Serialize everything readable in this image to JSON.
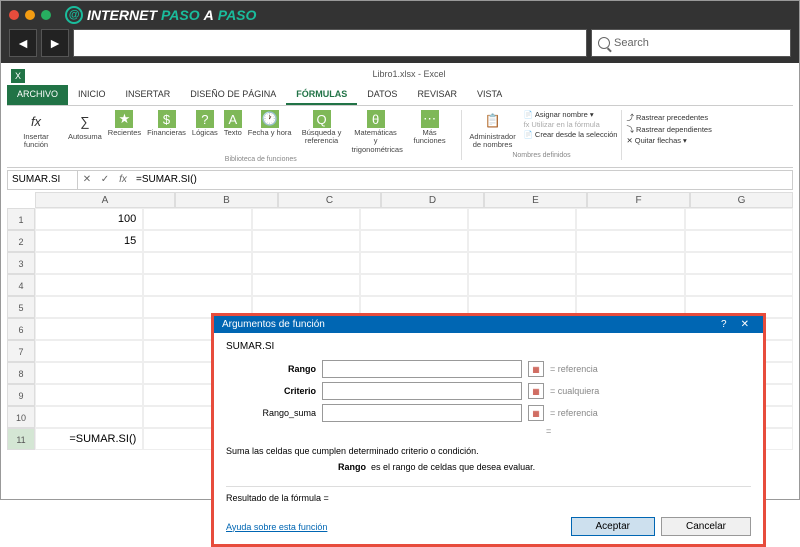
{
  "browser": {
    "logo_text1": "INTERNET",
    "logo_text2": "PASO",
    "logo_text3": "A",
    "logo_text4": "PASO",
    "search_placeholder": "Search"
  },
  "excel": {
    "doc_title": "Libro1.xlsx - Excel",
    "tabs": {
      "archivo": "ARCHIVO",
      "inicio": "INICIO",
      "insertar": "INSERTAR",
      "diseno": "DISEÑO DE PÁGINA",
      "formulas": "FÓRMULAS",
      "datos": "DATOS",
      "revisar": "REVISAR",
      "vista": "VISTA"
    },
    "ribbon": {
      "insertar_fn": "Insertar función",
      "autosuma": "Autosuma",
      "recientes": "Recientes",
      "financieras": "Financieras",
      "logicas": "Lógicas",
      "texto": "Texto",
      "fecha": "Fecha y hora",
      "busqueda": "Búsqueda y referencia",
      "matematicas": "Matemáticas y trigonométricas",
      "mas": "Más funciones",
      "biblioteca": "Biblioteca de funciones",
      "admin": "Administrador de nombres",
      "asignar": "Asignar nombre",
      "utilizar": "Utilizar en la fórmula",
      "crear": "Crear desde la selección",
      "nombres": "Nombres definidos",
      "precedentes": "Rastrear precedentes",
      "dependientes": "Rastrear dependientes",
      "quitar": "Quitar flechas"
    },
    "namebox": "SUMAR.SI",
    "formula": "=SUMAR.SI()",
    "cols": [
      "A",
      "B",
      "C",
      "D",
      "E",
      "F",
      "G"
    ],
    "a1": "100",
    "a2": "15",
    "a11": "=SUMAR.SI()"
  },
  "dialog": {
    "title": "Argumentos de función",
    "fn": "SUMAR.SI",
    "rango": "Rango",
    "criterio": "Criterio",
    "rango_suma": "Rango_suma",
    "hint_ref": "referencia",
    "hint_any": "cualquiera",
    "desc": "Suma las celdas que cumplen determinado criterio o condición.",
    "desc2_lbl": "Rango",
    "desc2_txt": "es el rango de celdas que desea evaluar.",
    "resultado": "Resultado de la fórmula =",
    "ayuda": "Ayuda sobre esta función",
    "aceptar": "Aceptar",
    "cancelar": "Cancelar"
  }
}
